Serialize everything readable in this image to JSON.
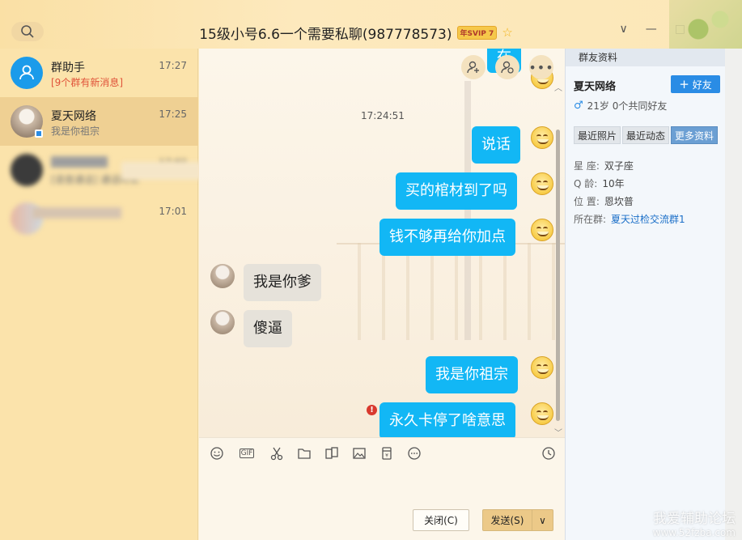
{
  "window": {
    "title": "15级小号6.6一个需要私聊(987778573)",
    "svip_badge": "年SVIP 7",
    "controls": [
      "∨",
      "—",
      "□"
    ]
  },
  "sidebar": {
    "items": [
      {
        "name": "群助手",
        "sub": "[9个群有新消息]",
        "time": "17:27"
      },
      {
        "name": "夏天网络",
        "sub": "我是你祖宗",
        "time": "17:25"
      },
      {
        "name": "",
        "sub": "[语音通话] 通话时长",
        "time": "17:02"
      },
      {
        "name": "",
        "sub": "",
        "time": "17:01"
      }
    ]
  },
  "chat": {
    "timestamp": "17:24:51",
    "partial_top": "在",
    "messages": [
      {
        "dir": "out",
        "text": "说话"
      },
      {
        "dir": "out",
        "text": "买的棺材到了吗"
      },
      {
        "dir": "out",
        "text": "钱不够再给你加点"
      },
      {
        "dir": "in",
        "text": "我是你爹"
      },
      {
        "dir": "in",
        "text": "傻逼"
      },
      {
        "dir": "out",
        "text": "我是你祖宗"
      },
      {
        "dir": "out",
        "text": "永久卡停了啥意思",
        "error": true
      }
    ]
  },
  "toolbar": {
    "items": [
      "emoji-icon",
      "gif-icon",
      "scissors-icon",
      "folder-icon",
      "image-icon",
      "redpacket-icon",
      "more-icon"
    ],
    "gif_label": "GIF"
  },
  "actions": {
    "close_label": "关闭(C)",
    "send_label": "发送(S)"
  },
  "profile_panel": {
    "header": "群友资料",
    "name": "夏天网络",
    "add_friend": "好友",
    "info": "21岁  0个共同好友",
    "tabs": [
      "最近照片",
      "最近动态",
      "更多资料"
    ],
    "fields": [
      {
        "label": "星  座:",
        "value": "双子座"
      },
      {
        "label": "Q    龄:",
        "value": "10年"
      },
      {
        "label": "位  置:",
        "value": "恩坎普"
      },
      {
        "label": "所在群:",
        "value": "夏天过检交流群1"
      }
    ]
  },
  "watermark": {
    "line1": "我爱辅助论坛",
    "line2": "www.52fzba.com"
  },
  "colors": {
    "out_bubble": "#12b7f5",
    "in_bubble": "#e6e2da",
    "sidebar_bg": "#fbe3ab",
    "accent": "#2a8ce5"
  }
}
